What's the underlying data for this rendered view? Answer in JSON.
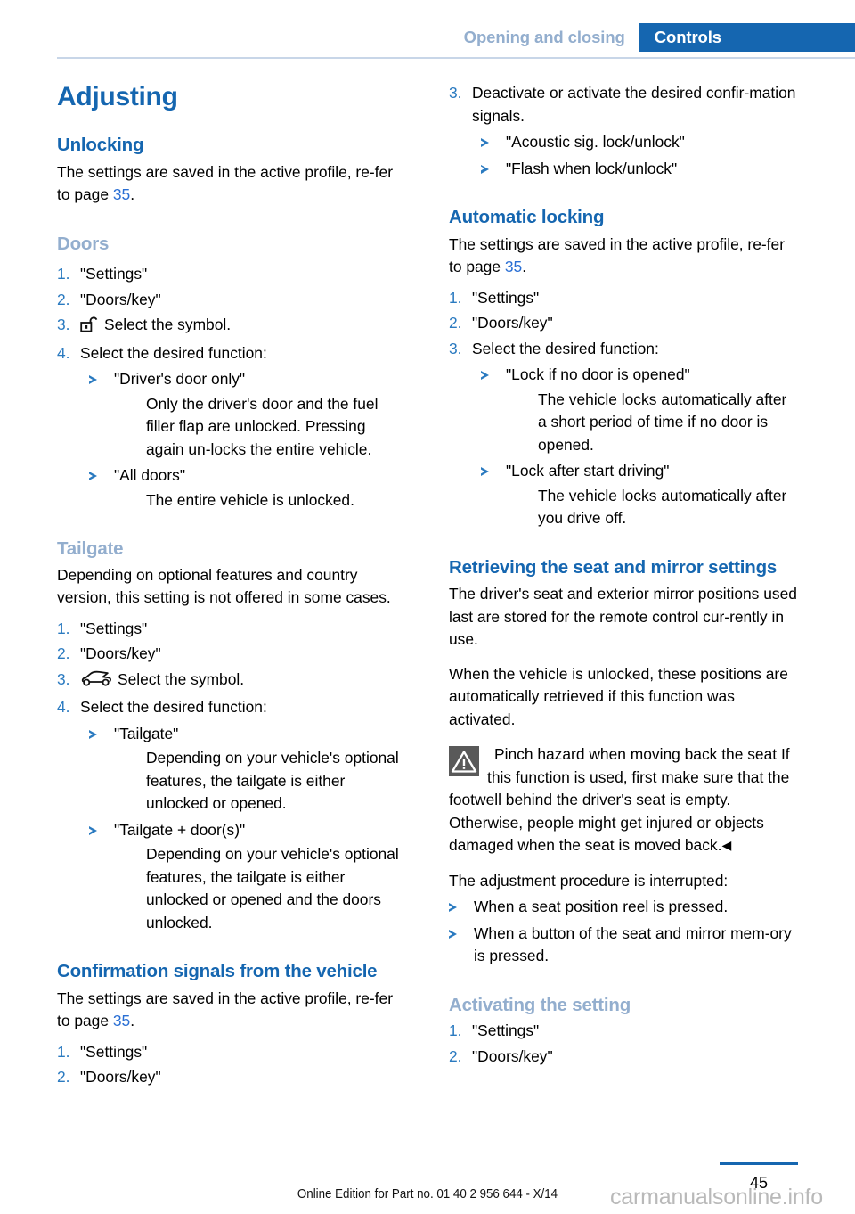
{
  "header": {
    "section_label": "Opening and closing",
    "chapter_label": "Controls"
  },
  "page_title": "Adjusting",
  "left_column": {
    "unlocking": {
      "heading": "Unlocking",
      "intro_before": "The settings are saved in the active profile, re-fer to page ",
      "intro_ref": "35",
      "intro_after": "."
    },
    "doors": {
      "heading": "Doors",
      "steps": [
        {
          "num": "1.",
          "text": "\"Settings\""
        },
        {
          "num": "2.",
          "text": "\"Doors/key\""
        },
        {
          "num": "3.",
          "icon": "unlocked-padlock-icon",
          "text": "Select the symbol."
        },
        {
          "num": "4.",
          "text": "Select the desired function:"
        }
      ],
      "options": [
        {
          "label": "\"Driver's door only\"",
          "description": "Only the driver's door and the fuel filler flap are unlocked. Pressing again un-locks the entire vehicle."
        },
        {
          "label": "\"All doors\"",
          "description": "The entire vehicle is unlocked."
        }
      ]
    },
    "tailgate": {
      "heading": "Tailgate",
      "intro": "Depending on optional features and country version, this setting is not offered in some cases.",
      "steps": [
        {
          "num": "1.",
          "text": "\"Settings\""
        },
        {
          "num": "2.",
          "text": "\"Doors/key\""
        },
        {
          "num": "3.",
          "icon": "car-tailgate-icon",
          "text": "Select the symbol."
        },
        {
          "num": "4.",
          "text": "Select the desired function:"
        }
      ],
      "options": [
        {
          "label": "\"Tailgate\"",
          "description": "Depending on your vehicle's optional features, the tailgate is either unlocked or opened."
        },
        {
          "label": "\"Tailgate + door(s)\"",
          "description": "Depending on your vehicle's optional features, the tailgate is either unlocked or opened and the doors unlocked."
        }
      ]
    },
    "confirmation_signals": {
      "heading": "Confirmation signals from the vehicle",
      "intro_before": "The settings are saved in the active profile, re-fer to page ",
      "intro_ref": "35",
      "intro_after": ".",
      "steps": [
        {
          "num": "1.",
          "text": "\"Settings\""
        },
        {
          "num": "2.",
          "text": "\"Doors/key\""
        }
      ]
    }
  },
  "right_column": {
    "confirmation_continued": {
      "steps": [
        {
          "num": "3.",
          "text": "Deactivate or activate the desired confir-mation signals."
        }
      ],
      "options": [
        {
          "label": "\"Acoustic sig. lock/unlock\""
        },
        {
          "label": "\"Flash when lock/unlock\""
        }
      ]
    },
    "automatic_locking": {
      "heading": "Automatic locking",
      "intro_before": "The settings are saved in the active profile, re-fer to page ",
      "intro_ref": "35",
      "intro_after": ".",
      "steps": [
        {
          "num": "1.",
          "text": "\"Settings\""
        },
        {
          "num": "2.",
          "text": "\"Doors/key\""
        },
        {
          "num": "3.",
          "text": "Select the desired function:"
        }
      ],
      "options": [
        {
          "label": "\"Lock if no door is opened\"",
          "description": "The vehicle locks automatically after a short period of time if no door is opened."
        },
        {
          "label": "\"Lock after start driving\"",
          "description": "The vehicle locks automatically after you drive off."
        }
      ]
    },
    "retrieving": {
      "heading": "Retrieving the seat and mirror settings",
      "para1": "The driver's seat and exterior mirror positions used last are stored for the remote control cur-rently in use.",
      "para2": "When the vehicle is unlocked, these positions are automatically retrieved if this function was activated.",
      "warning": {
        "icon": "warning-triangle-icon",
        "title": "Pinch hazard when moving back the seat",
        "body": "If this function is used, first make sure that the footwell behind the driver's seat is empty. Otherwise, people might get injured or objects damaged when the seat is moved back.",
        "end_mark": "◀"
      },
      "para3": "The adjustment procedure is interrupted:",
      "bullets": [
        {
          "label": "When a seat position reel is pressed."
        },
        {
          "label": "When a button of the seat and mirror mem-ory is pressed."
        }
      ]
    },
    "activating": {
      "heading": "Activating the setting",
      "steps": [
        {
          "num": "1.",
          "text": "\"Settings\""
        },
        {
          "num": "2.",
          "text": "\"Doors/key\""
        }
      ]
    }
  },
  "footer": {
    "edition": "Online Edition for Part no. 01 40 2 956 644 - X/14",
    "page_number": "45",
    "watermark": "carmanualsonline.info"
  },
  "colors": {
    "heading_blue": "#1566b0",
    "muted_blue": "#93aece",
    "link_blue": "#2a6fd4",
    "tab_blue": "#1566b0",
    "warning_gray": "#595959"
  }
}
